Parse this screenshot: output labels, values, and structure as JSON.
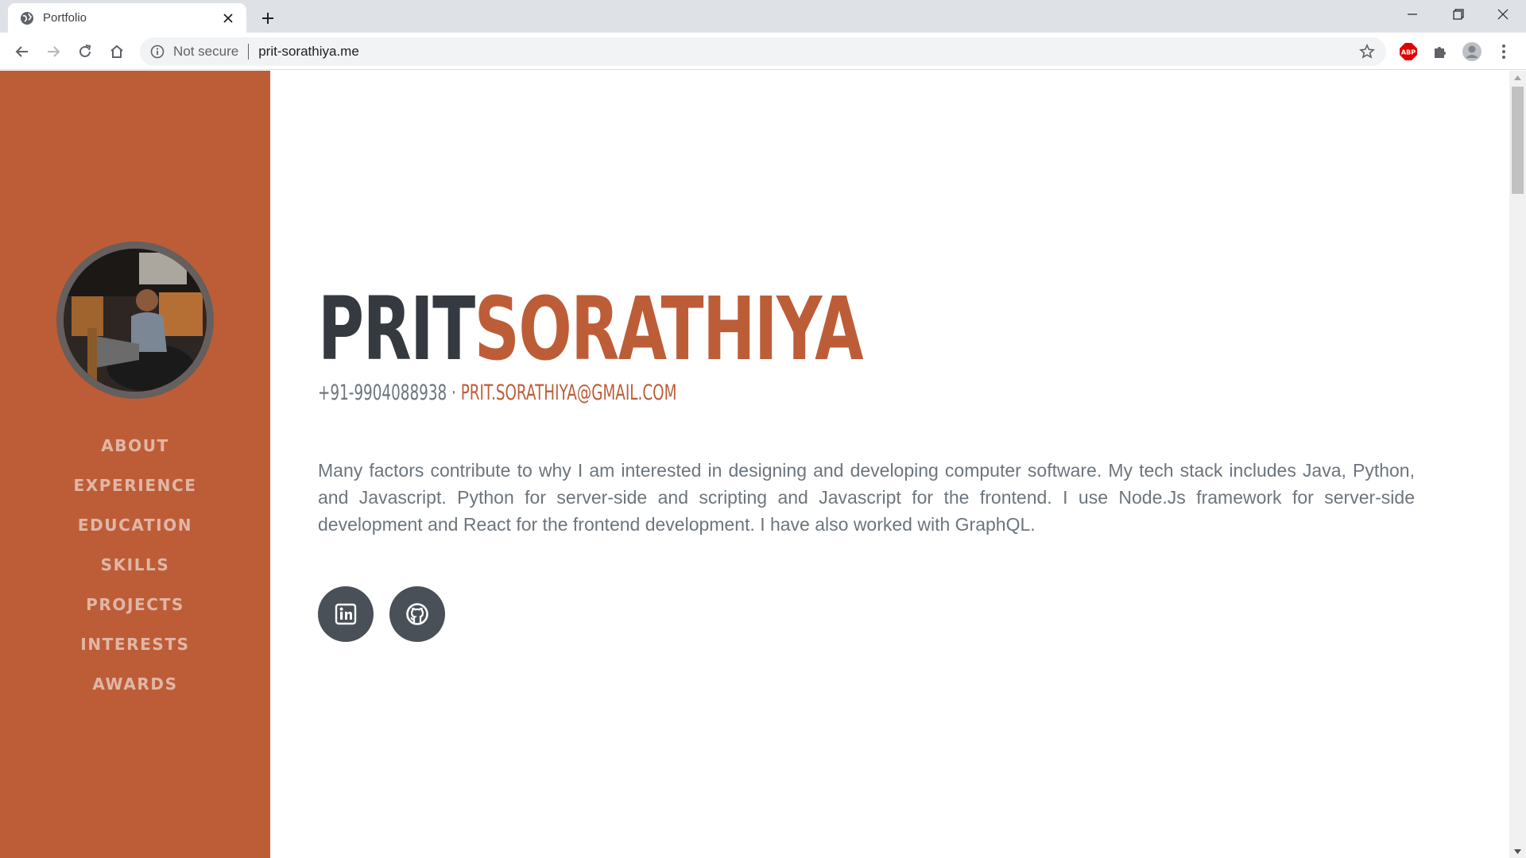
{
  "browser": {
    "tab_title": "Portfolio",
    "security_label": "Not secure",
    "url": "prit-sorathiya.me",
    "extension_abp_label": "ABP"
  },
  "profile": {
    "first_name": "PRIT",
    "last_name": "SORATHIYA",
    "phone": "+91-9904088938",
    "contact_separator": " · ",
    "email": "prit.sorathiya@gmail.com",
    "about": "Many factors contribute to why I am interested in designing and developing computer software. My tech stack includes Java, Python, and Javascript. Python for server-side and scripting and Javascript for the frontend. I use Node.Js framework for server-side development and React for the frontend development. I have also worked with GraphQL."
  },
  "nav": {
    "items": [
      {
        "label": "About"
      },
      {
        "label": "Experience"
      },
      {
        "label": "Education"
      },
      {
        "label": "Skills"
      },
      {
        "label": "Projects"
      },
      {
        "label": "Interests"
      },
      {
        "label": "Awards"
      }
    ]
  },
  "social": {
    "items": [
      {
        "icon": "linkedin-icon"
      },
      {
        "icon": "github-icon"
      }
    ]
  },
  "colors": {
    "primary": "#bd5d38",
    "dark": "#343a40",
    "muted": "#6c757d",
    "social_bg": "#495057"
  }
}
